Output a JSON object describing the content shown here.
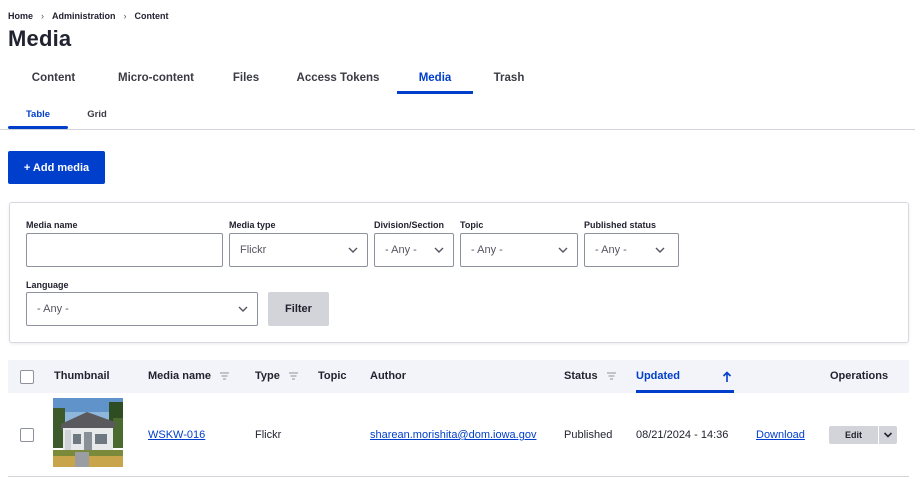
{
  "breadcrumb": {
    "items": [
      "Home",
      "Administration",
      "Content"
    ],
    "separator": "›"
  },
  "page_title": "Media",
  "primary_tabs": [
    {
      "label": "Content",
      "active": false
    },
    {
      "label": "Micro-content",
      "active": false
    },
    {
      "label": "Files",
      "active": false
    },
    {
      "label": "Access Tokens",
      "active": false
    },
    {
      "label": "Media",
      "active": true
    },
    {
      "label": "Trash",
      "active": false
    }
  ],
  "secondary_tabs": [
    {
      "label": "Table",
      "active": true
    },
    {
      "label": "Grid",
      "active": false
    }
  ],
  "add_media_label": "+ Add media",
  "filters": {
    "media_name": {
      "label": "Media name",
      "value": ""
    },
    "media_type": {
      "label": "Media type",
      "value": "Flickr"
    },
    "division": {
      "label": "Division/Section",
      "value": "- Any -"
    },
    "topic": {
      "label": "Topic",
      "value": "- Any -"
    },
    "published_status": {
      "label": "Published status",
      "value": "- Any -"
    },
    "language": {
      "label": "Language",
      "value": "- Any -"
    },
    "filter_button": "Filter"
  },
  "table": {
    "headers": {
      "thumbnail": "Thumbnail",
      "media_name": "Media name",
      "type": "Type",
      "topic": "Topic",
      "author": "Author",
      "status": "Status",
      "updated": "Updated",
      "operations": "Operations"
    },
    "sorted_column": "updated",
    "sort_direction": "ascending",
    "rows": [
      {
        "media_name": "WSKW-016",
        "type": "Flickr",
        "topic": "",
        "author": "sharean.morishita@dom.iowa.gov",
        "status": "Published",
        "updated": "08/21/2024 - 14:36",
        "download": "Download",
        "edit": "Edit"
      }
    ]
  },
  "colors": {
    "accent": "#003ecc",
    "header_bg": "#f3f4f9",
    "button_grey": "#d3d4d9"
  }
}
